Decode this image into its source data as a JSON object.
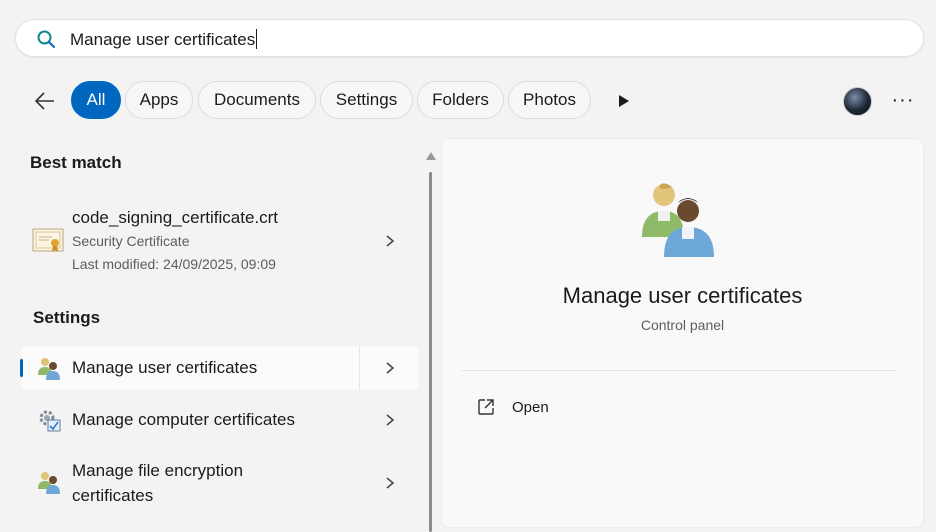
{
  "search": {
    "query": "Manage user certificates"
  },
  "filters": [
    "All",
    "Apps",
    "Documents",
    "Settings",
    "Folders",
    "Photos"
  ],
  "active_filter": "All",
  "best_match": {
    "heading": "Best match",
    "title": "code_signing_certificate.crt",
    "type": "Security Certificate",
    "modified": "Last modified: 24/09/2025, 09:09"
  },
  "settings": {
    "heading": "Settings",
    "items": [
      {
        "label": "Manage user certificates",
        "icon": "users-icon"
      },
      {
        "label": "Manage computer certificates",
        "icon": "computer-cert-icon"
      },
      {
        "label_line1": "Manage file encryption",
        "label_line2": "certificates",
        "icon": "users-icon"
      }
    ]
  },
  "detail": {
    "title": "Manage user certificates",
    "subtitle": "Control panel",
    "actions": [
      {
        "label": "Open",
        "icon": "open-external-icon"
      }
    ]
  },
  "colors": {
    "accent": "#0067c0",
    "background": "#f3f3f3"
  }
}
